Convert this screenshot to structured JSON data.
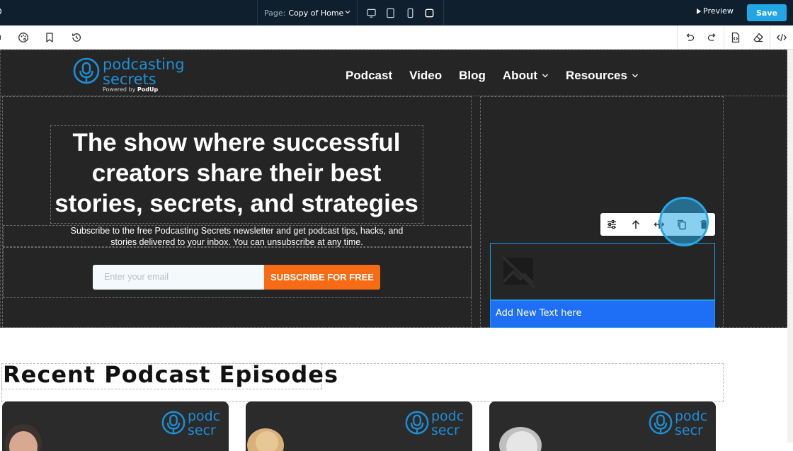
{
  "topbar": {
    "page_label": "Page:",
    "page_value": "Copy of Home",
    "preview_label": "Preview",
    "save_label": "Save"
  },
  "hero": {
    "logo": {
      "word1": "podcasting",
      "word2": "secrets",
      "powered_prefix": "Powered by",
      "powered_brand": "PodUp"
    },
    "nav": [
      {
        "label": "Podcast"
      },
      {
        "label": "Video"
      },
      {
        "label": "Blog"
      },
      {
        "label": "About"
      },
      {
        "label": "Resources"
      }
    ],
    "headline": "The show where successful creators share their best stories, secrets, and strategies",
    "subtext": "Subscribe to the free Podcasting Secrets newsletter and get podcast tips, hacks, and stories delivered to your inbox. You can unsubscribe at any time.",
    "email_placeholder": "Enter your email",
    "subscribe_label": "SUBSCRIBE FOR FREE"
  },
  "editor": {
    "new_text_label": "Add New Text here"
  },
  "episodes": {
    "section_title": "Recent Podcast Episodes",
    "card_logo_word1": "podc",
    "card_logo_word2": "secr"
  },
  "colors": {
    "topbar_bg": "#0f1f2e",
    "save_button": "#22a7e6",
    "hero_bg": "#252525",
    "brand_blue": "#1e8fd6",
    "subscribe_orange": "#f76b15",
    "selection_blue": "#1e6ff5",
    "highlight": "#28a7e3"
  },
  "icons": {
    "devices": [
      "desktop-icon",
      "tablet-icon",
      "mobile-icon",
      "square-icon"
    ],
    "toolbar_left": [
      "palette-icon",
      "bookmark-icon",
      "history-icon"
    ],
    "toolbar_right": [
      "undo-icon",
      "redo-icon",
      "code-file-icon",
      "eraser-icon",
      "code-icon"
    ],
    "element_toolbar": [
      "settings-sliders-icon",
      "arrow-up-icon",
      "move-icon",
      "copy-icon",
      "trash-icon"
    ]
  }
}
